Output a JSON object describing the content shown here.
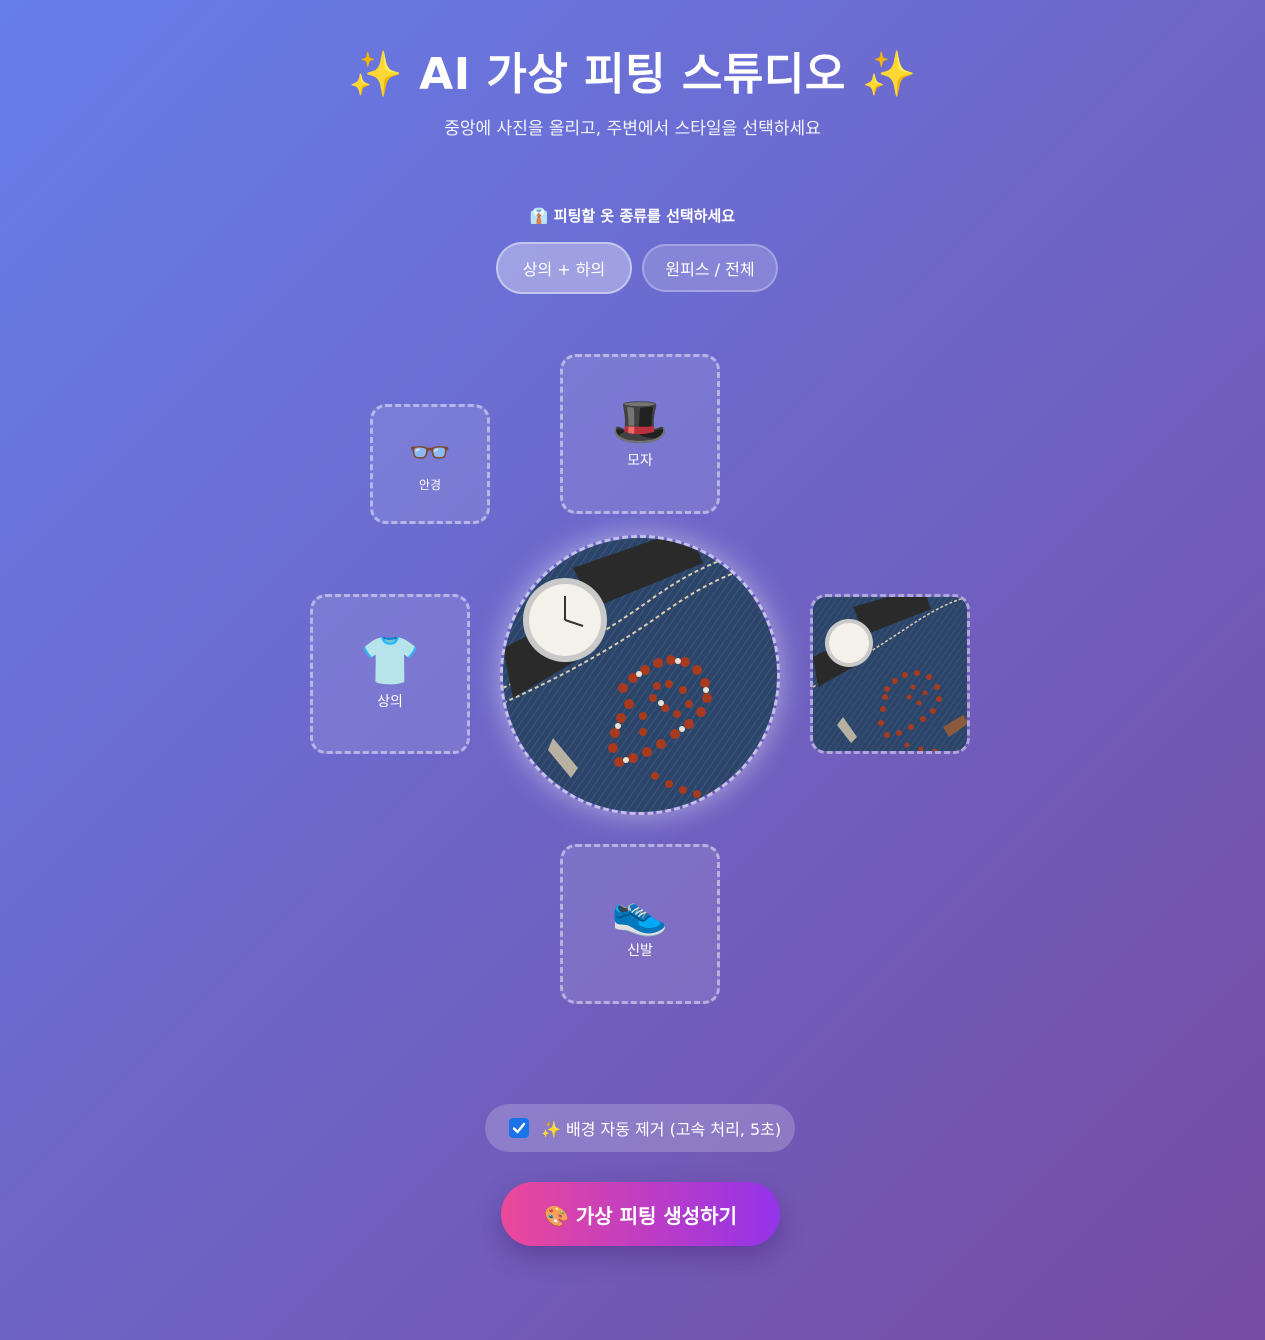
{
  "header": {
    "title": "✨ AI 가상 피팅 스튜디오 ✨",
    "subtitle": "중앙에 사진을 올리고, 주변에서 스타일을 선택하세요"
  },
  "clothing_type": {
    "title": "👔 피팅할 옷 종류를 선택하세요",
    "options": [
      {
        "label": "상의 + 하의",
        "selected": true
      },
      {
        "label": "원피스 / 전체",
        "selected": false
      }
    ]
  },
  "slots": {
    "hat": {
      "emoji": "🎩",
      "label": "모자"
    },
    "glasses": {
      "emoji": "👓",
      "label": "안경"
    },
    "top": {
      "emoji": "👕",
      "label": "상의"
    },
    "shoes": {
      "emoji": "👟",
      "label": "신발"
    }
  },
  "options": {
    "remove_bg_label": "✨ 배경 자동 제거 (고속 처리, 5초)",
    "remove_bg_checked": true
  },
  "actions": {
    "generate_label": "🎨 가상 피팅 생성하기"
  },
  "colors": {
    "bg_start": "#667eea",
    "bg_end": "#764ba2",
    "button_start": "#ec4899",
    "button_end": "#9333ea",
    "checkbox": "#1a73e8"
  }
}
